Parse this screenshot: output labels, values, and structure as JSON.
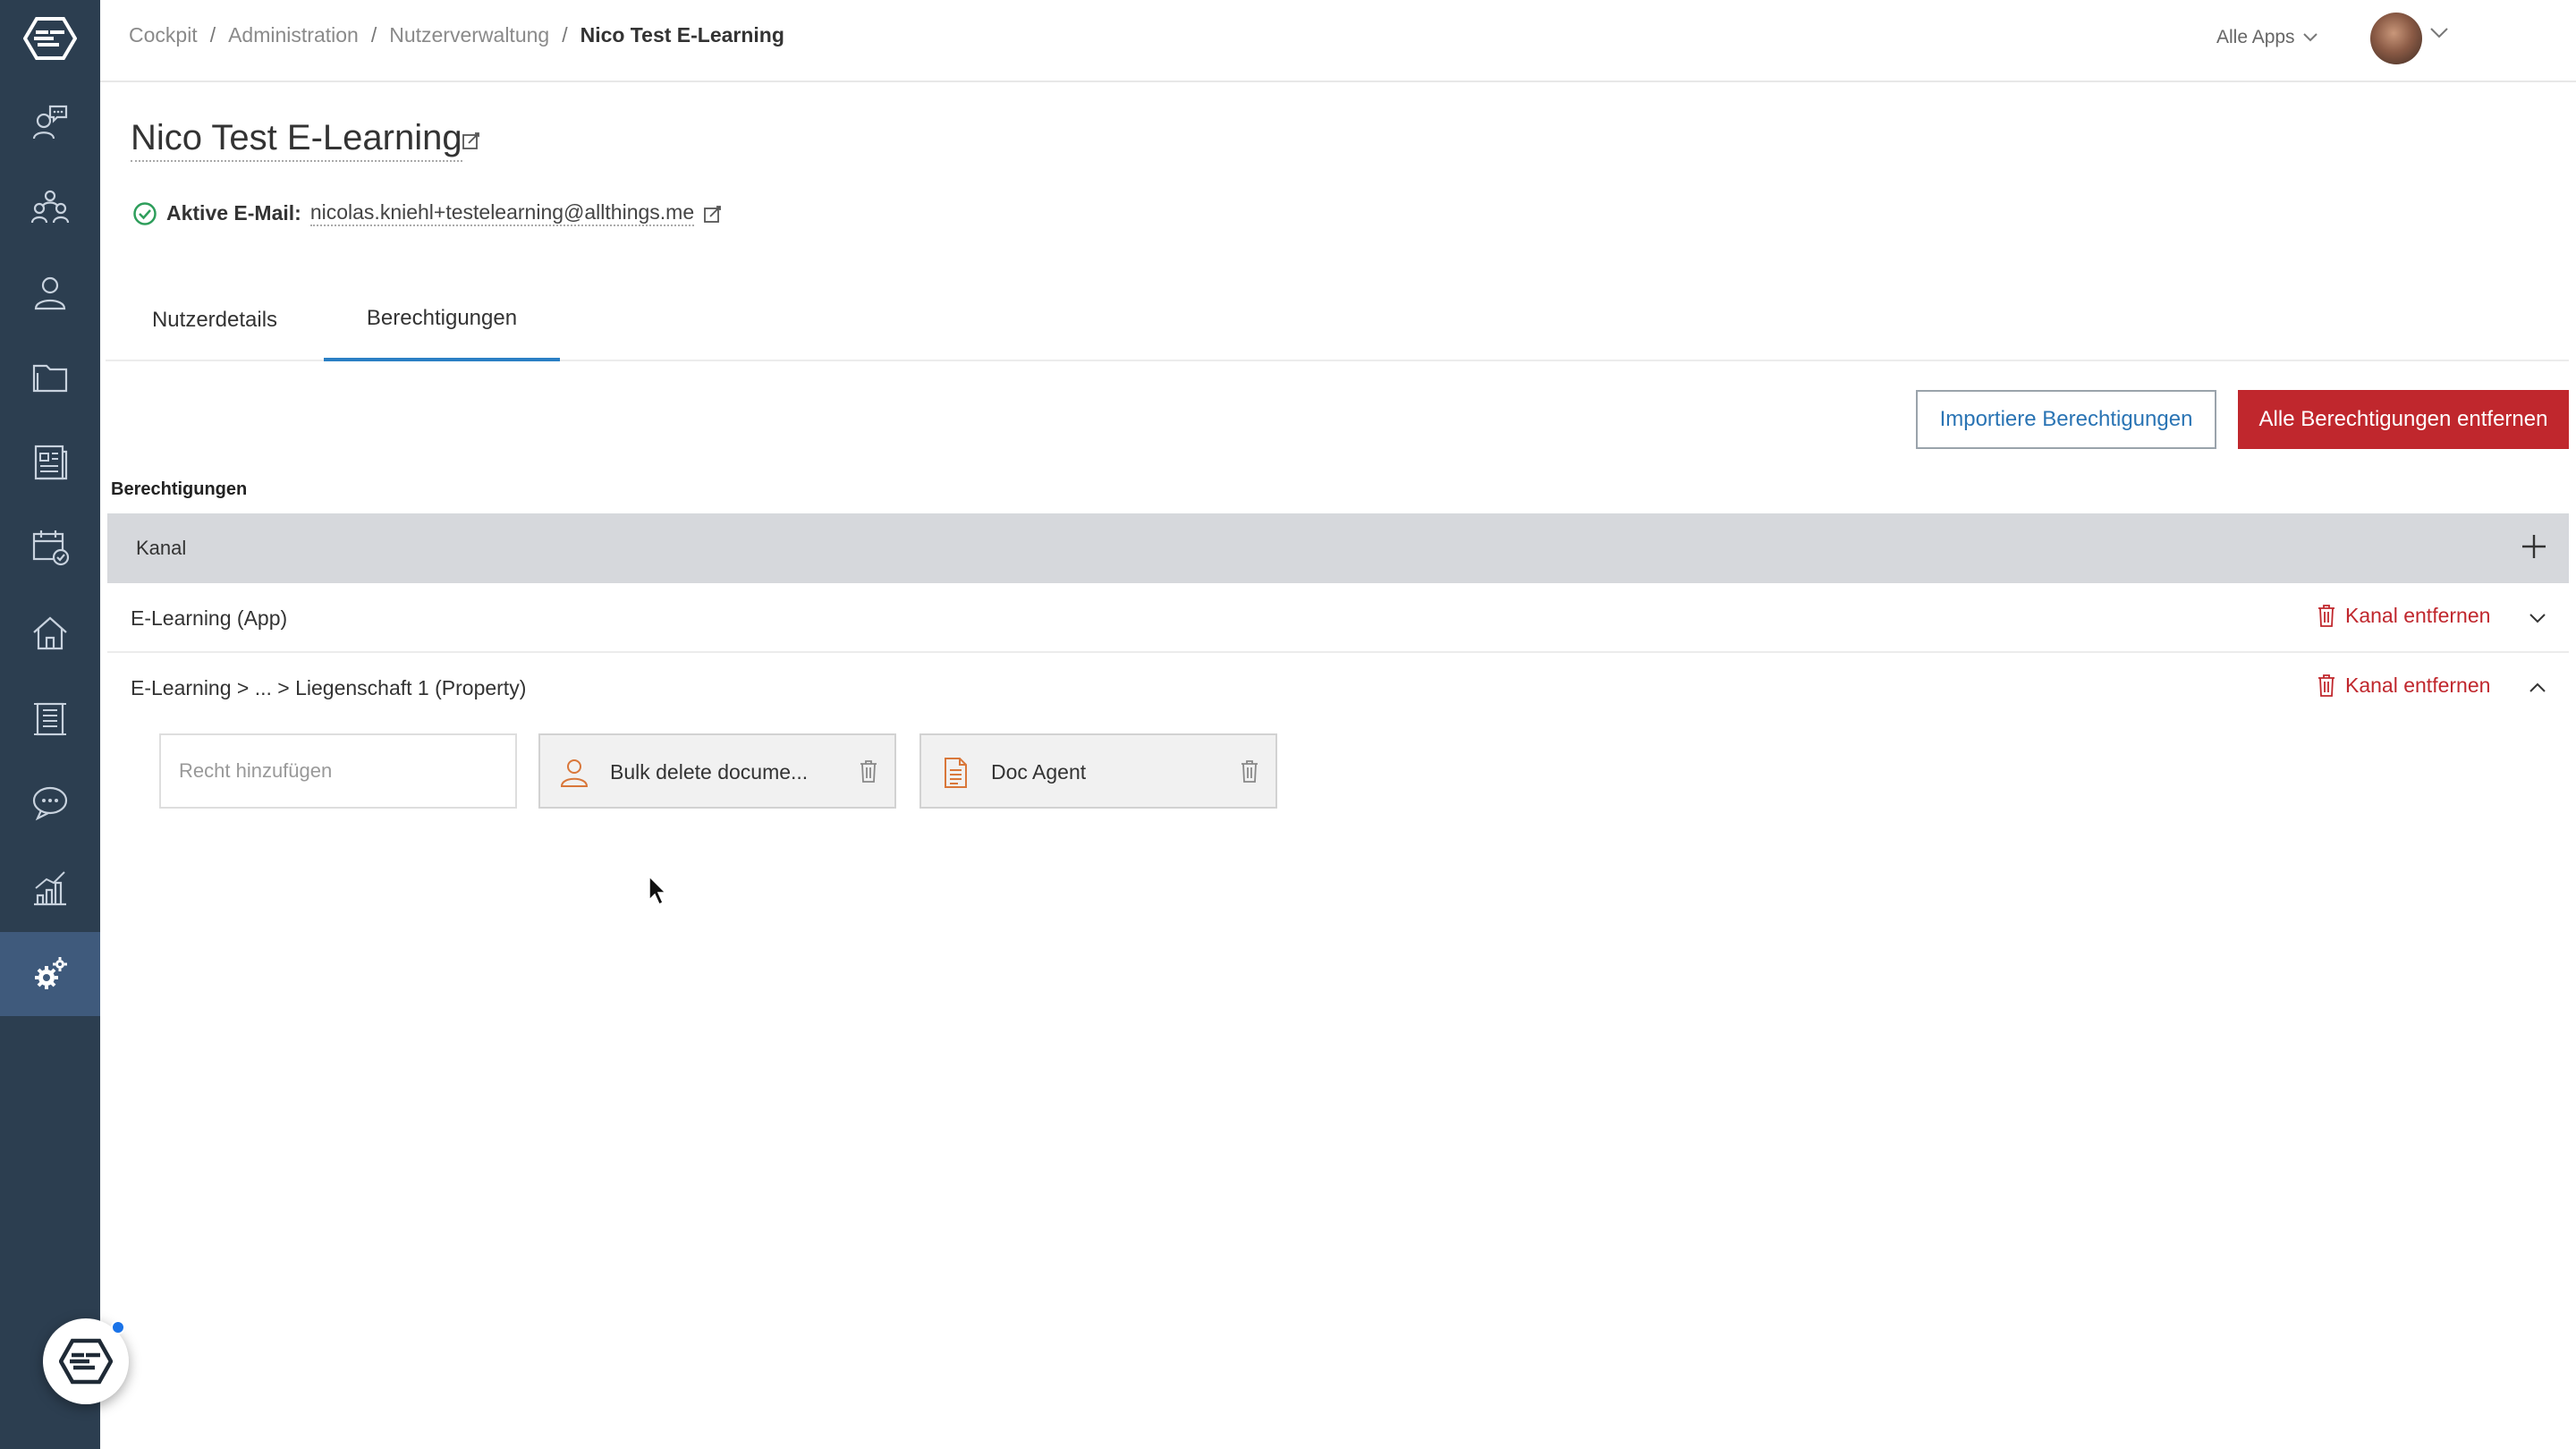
{
  "header": {
    "breadcrumb": [
      "Cockpit",
      "Administration",
      "Nutzerverwaltung"
    ],
    "breadcrumb_current": "Nico Test E-Learning",
    "apps_select": "Alle Apps"
  },
  "user": {
    "name": "Nico Test E-Learning",
    "email_label": "Aktive E-Mail:",
    "email": "nicolas.kniehl+testelearning@allthings.me"
  },
  "tabs": [
    {
      "label": "Nutzerdetails",
      "active": false
    },
    {
      "label": "Berechtigungen",
      "active": true
    }
  ],
  "actions": {
    "import_label": "Importiere Berechtigungen",
    "remove_all_label": "Alle Berechtigungen entfernen"
  },
  "permissions": {
    "section_label": "Berechtigungen",
    "channel_header": "Kanal",
    "channels": [
      {
        "label": "E-Learning (App)",
        "remove_label": "Kanal entfernen",
        "expanded": false
      },
      {
        "label": "E-Learning > ... > Liegenschaft 1 (Property)",
        "remove_label": "Kanal entfernen",
        "expanded": true
      }
    ],
    "add_placeholder": "Recht hinzufügen",
    "rights": [
      {
        "label": "Bulk delete docume...",
        "icon": "user-icon"
      },
      {
        "label": "Doc Agent",
        "icon": "document-icon"
      }
    ]
  },
  "colors": {
    "sidebar": "#2c3e50",
    "sidebar_active": "#3f5a7c",
    "danger": "#c0272d",
    "link": "#2a74b4",
    "tab_active": "#2a7fc4",
    "channel_header_bg": "#d6d8dc"
  }
}
